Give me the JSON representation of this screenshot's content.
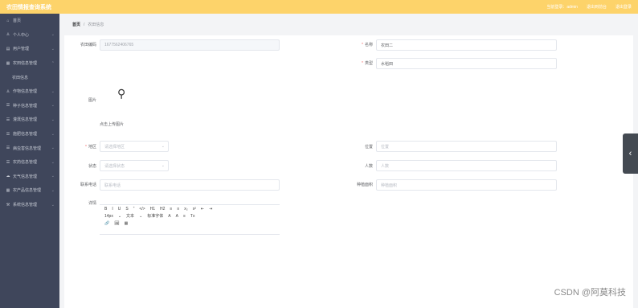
{
  "header": {
    "title": "农田情报查询系统",
    "links": [
      "当前登录：admin",
      "退出到前台",
      "退出登录"
    ]
  },
  "sidebar": {
    "items": [
      {
        "label": "首页",
        "icon": "home-icon",
        "has_chevron": false
      },
      {
        "label": "个人中心",
        "icon": "user-icon",
        "has_chevron": true
      },
      {
        "label": "用户管理",
        "icon": "users-icon",
        "has_chevron": true
      },
      {
        "label": "农田信息管理",
        "icon": "grid-icon",
        "has_chevron": true
      },
      {
        "label": "农田信息",
        "icon": "",
        "sub": true,
        "has_chevron": false
      },
      {
        "label": "作物信息管理",
        "icon": "person-icon",
        "has_chevron": true
      },
      {
        "label": "种子信息管理",
        "icon": "list-icon",
        "has_chevron": true
      },
      {
        "label": "灌溉信息管理",
        "icon": "list-icon",
        "has_chevron": true
      },
      {
        "label": "施肥信息管理",
        "icon": "list-icon",
        "has_chevron": true
      },
      {
        "label": "病虫害信息管理",
        "icon": "list-icon",
        "has_chevron": true
      },
      {
        "label": "农药信息管理",
        "icon": "list-icon",
        "has_chevron": true
      },
      {
        "label": "天气信息管理",
        "icon": "cloud-icon",
        "has_chevron": true
      },
      {
        "label": "农产品信息管理",
        "icon": "grid-icon",
        "has_chevron": true
      },
      {
        "label": "系统信息管理",
        "icon": "tool-icon",
        "has_chevron": true
      }
    ]
  },
  "breadcrumb": {
    "home": "首页",
    "sep": "/",
    "current": "农田信息"
  },
  "form": {
    "field_code_label": "农田编码",
    "field_code_value": "1677562406765",
    "field_name_label": "名称",
    "field_name_value": "农田二",
    "field_type_label": "类型",
    "field_type_value": "水稻田",
    "image_label": "图片",
    "upload_tip": "点击上传图片",
    "place_label": "地区",
    "place_placeholder": "请选择地区",
    "location_label": "位置",
    "location_placeholder": "位置",
    "status_label": "状态",
    "status_placeholder": "请选择状态",
    "people_label": "人数",
    "people_placeholder": "人数",
    "phone_label": "联系电话",
    "phone_placeholder": "联系电话",
    "area_label": "种植面积",
    "area_placeholder": "种植面积",
    "desc_label": "详情"
  },
  "editor": {
    "row1": [
      "B",
      "I",
      "U",
      "S",
      "“",
      "</>",
      "H1",
      "H2",
      "≡",
      "≡",
      "x₂",
      "x²",
      "⇤",
      "⇥"
    ],
    "row2": [
      "14px",
      "文本",
      "标准字体",
      "A",
      "A",
      "≡",
      "Tx"
    ],
    "row3": [
      "🔗",
      "🖼",
      "▦"
    ]
  },
  "watermark": "CSDN @阿莫科技"
}
